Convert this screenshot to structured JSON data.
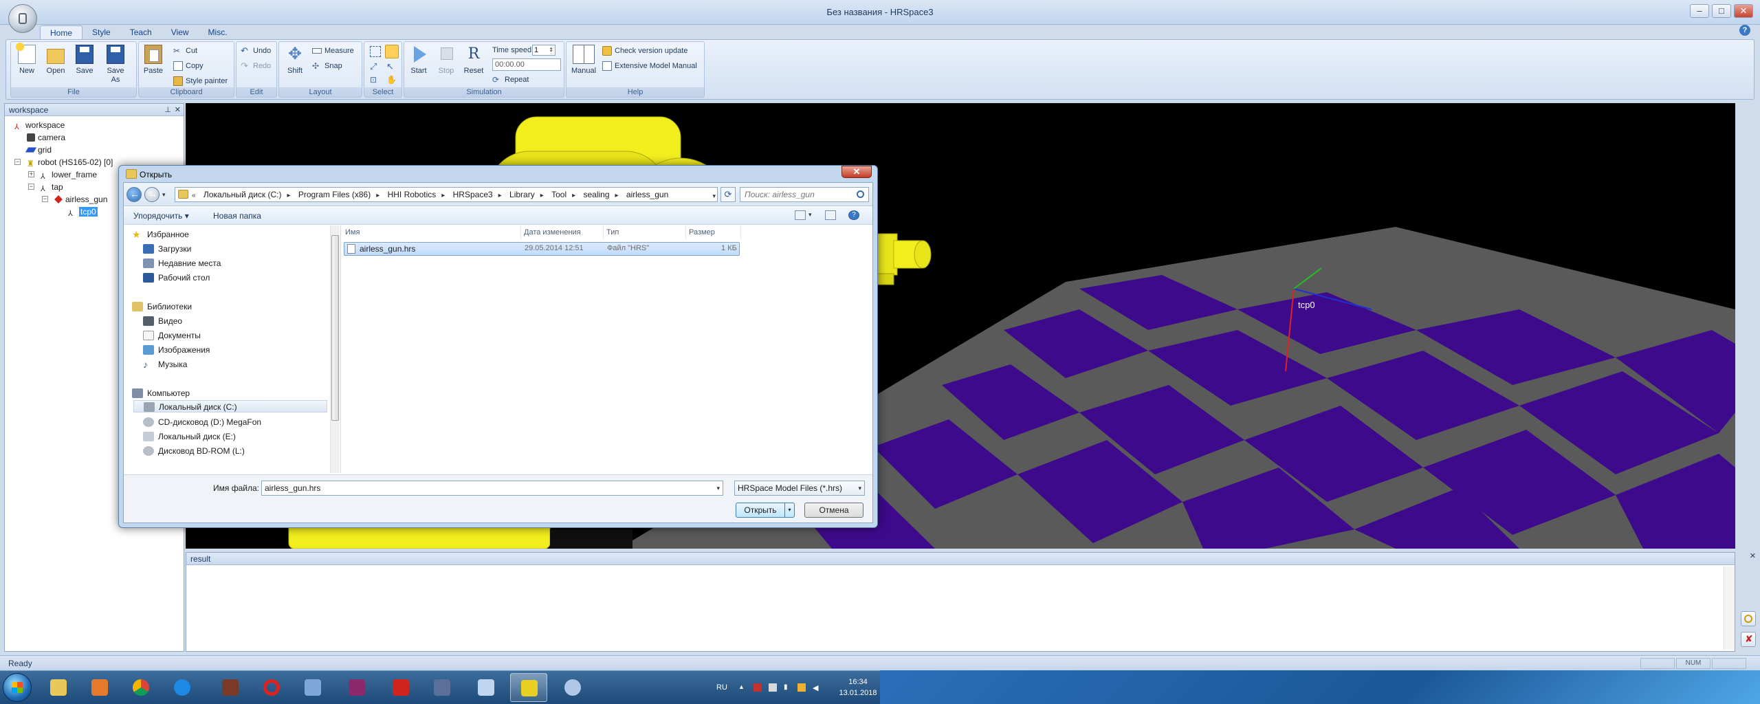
{
  "window": {
    "title": "Без названия - HRSpace3"
  },
  "ribbon": {
    "tabs": [
      "Home",
      "Style",
      "Teach",
      "View",
      "Misc."
    ],
    "groups": {
      "file": {
        "label": "File",
        "new": "New",
        "open": "Open",
        "save": "Save",
        "save_as": "Save As"
      },
      "clipboard": {
        "label": "Clipboard",
        "paste": "Paste",
        "cut": "Cut",
        "copy": "Copy",
        "style_painter": "Style painter"
      },
      "edit": {
        "label": "Edit",
        "undo": "Undo",
        "redo": "Redo"
      },
      "layout": {
        "label": "Layout",
        "shift": "Shift",
        "measure": "Measure",
        "snap": "Snap"
      },
      "select": {
        "label": "Select"
      },
      "simulation": {
        "label": "Simulation",
        "start": "Start",
        "stop": "Stop",
        "reset": "Reset",
        "time_speed_label": "Time speed",
        "time_speed_value": "1",
        "time_value": "00:00.00",
        "repeat": "Repeat"
      },
      "help": {
        "label": "Help",
        "manual": "Manual",
        "check_update": "Check version update",
        "extensive_manual": "Extensive Model Manual"
      }
    }
  },
  "workspace": {
    "title": "workspace",
    "tree": [
      "workspace",
      "camera",
      "grid",
      "robot (HS165-02) [0]",
      "lower_frame",
      "tap",
      "airless_gun",
      "tcp0"
    ]
  },
  "viewport": {
    "tcp_label": "tcp0"
  },
  "result": {
    "title": "result"
  },
  "statusbar": {
    "status": "Ready",
    "indicators": [
      "",
      "NUM",
      ""
    ]
  },
  "dialog": {
    "title": "Открыть",
    "path": [
      "Локальный диск (C:)",
      "Program Files (x86)",
      "HHI Robotics",
      "HRSpace3",
      "Library",
      "Tool",
      "sealing",
      "airless_gun"
    ],
    "search_placeholder": "Поиск: airless_gun",
    "organize": "Упорядочить ▾",
    "new_folder": "Новая папка",
    "nav": {
      "favorites": "Избранное",
      "downloads": "Загрузки",
      "recent": "Недавние места",
      "desktop": "Рабочий стол",
      "libraries": "Библиотеки",
      "video": "Видео",
      "documents": "Документы",
      "pictures": "Изображения",
      "music": "Музыка",
      "computer": "Компьютер",
      "disk_c": "Локальный диск (C:)",
      "cd_d": "CD-дисковод (D:) MegaFon",
      "disk_e": "Локальный диск (E:)",
      "bd_l": "Дисковод BD-ROM (L:)"
    },
    "columns": [
      "Имя",
      "Дата изменения",
      "Тип",
      "Размер"
    ],
    "files": [
      {
        "name": "airless_gun.hrs",
        "date": "29.05.2014 12:51",
        "type": "Файл \"HRS\"",
        "size": "1 КБ"
      }
    ],
    "filename_label": "Имя файла:",
    "filename_value": "airless_gun.hrs",
    "filetype": "HRSpace Model Files (*.hrs)",
    "open_button": "Открыть",
    "cancel_button": "Отмена"
  },
  "taskbar": {
    "lang": "RU",
    "time": "16:34",
    "date": "13.01.2018"
  },
  "colors": {
    "robot_yellow": "#f2ee1e",
    "floor_purple": "#3d0a8c",
    "floor_gray": "#5a5a5a",
    "ribbon_text": "#15428b"
  }
}
